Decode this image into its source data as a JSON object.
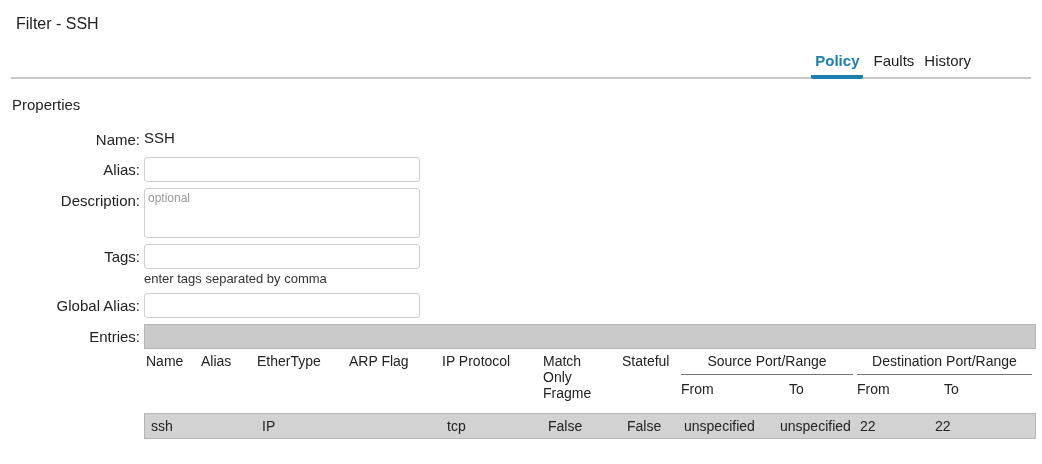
{
  "title": "Filter - SSH",
  "tabs": [
    {
      "label": "Policy",
      "selected": true
    },
    {
      "label": "Faults",
      "selected": false
    },
    {
      "label": "History",
      "selected": false
    }
  ],
  "section": "Properties",
  "form": [
    {
      "kind": "text",
      "label": "Name:",
      "value": "SSH"
    },
    {
      "kind": "input",
      "label": "Alias:"
    },
    {
      "kind": "textarea",
      "label": "Description:",
      "placeholder": "optional"
    },
    {
      "kind": "input",
      "label": "Tags:",
      "hint": "enter tags separated by comma"
    },
    {
      "kind": "input",
      "label": "Global Alias:"
    }
  ],
  "entries": {
    "label": "Entries:",
    "columns": [
      "Name",
      "Alias",
      "EtherType",
      "ARP Flag",
      "IP Protocol",
      "Match Only Fragme",
      "Stateful"
    ],
    "groups": [
      {
        "label": "Source Port/Range",
        "columns": [
          "From",
          "To"
        ]
      },
      {
        "label": "Destination Port/Range",
        "columns": [
          "From",
          "To"
        ]
      }
    ],
    "rows": [
      [
        "ssh",
        "",
        "IP",
        "",
        "tcp",
        "False",
        "False",
        "unspecified",
        "unspecified",
        "22",
        "22"
      ]
    ]
  }
}
